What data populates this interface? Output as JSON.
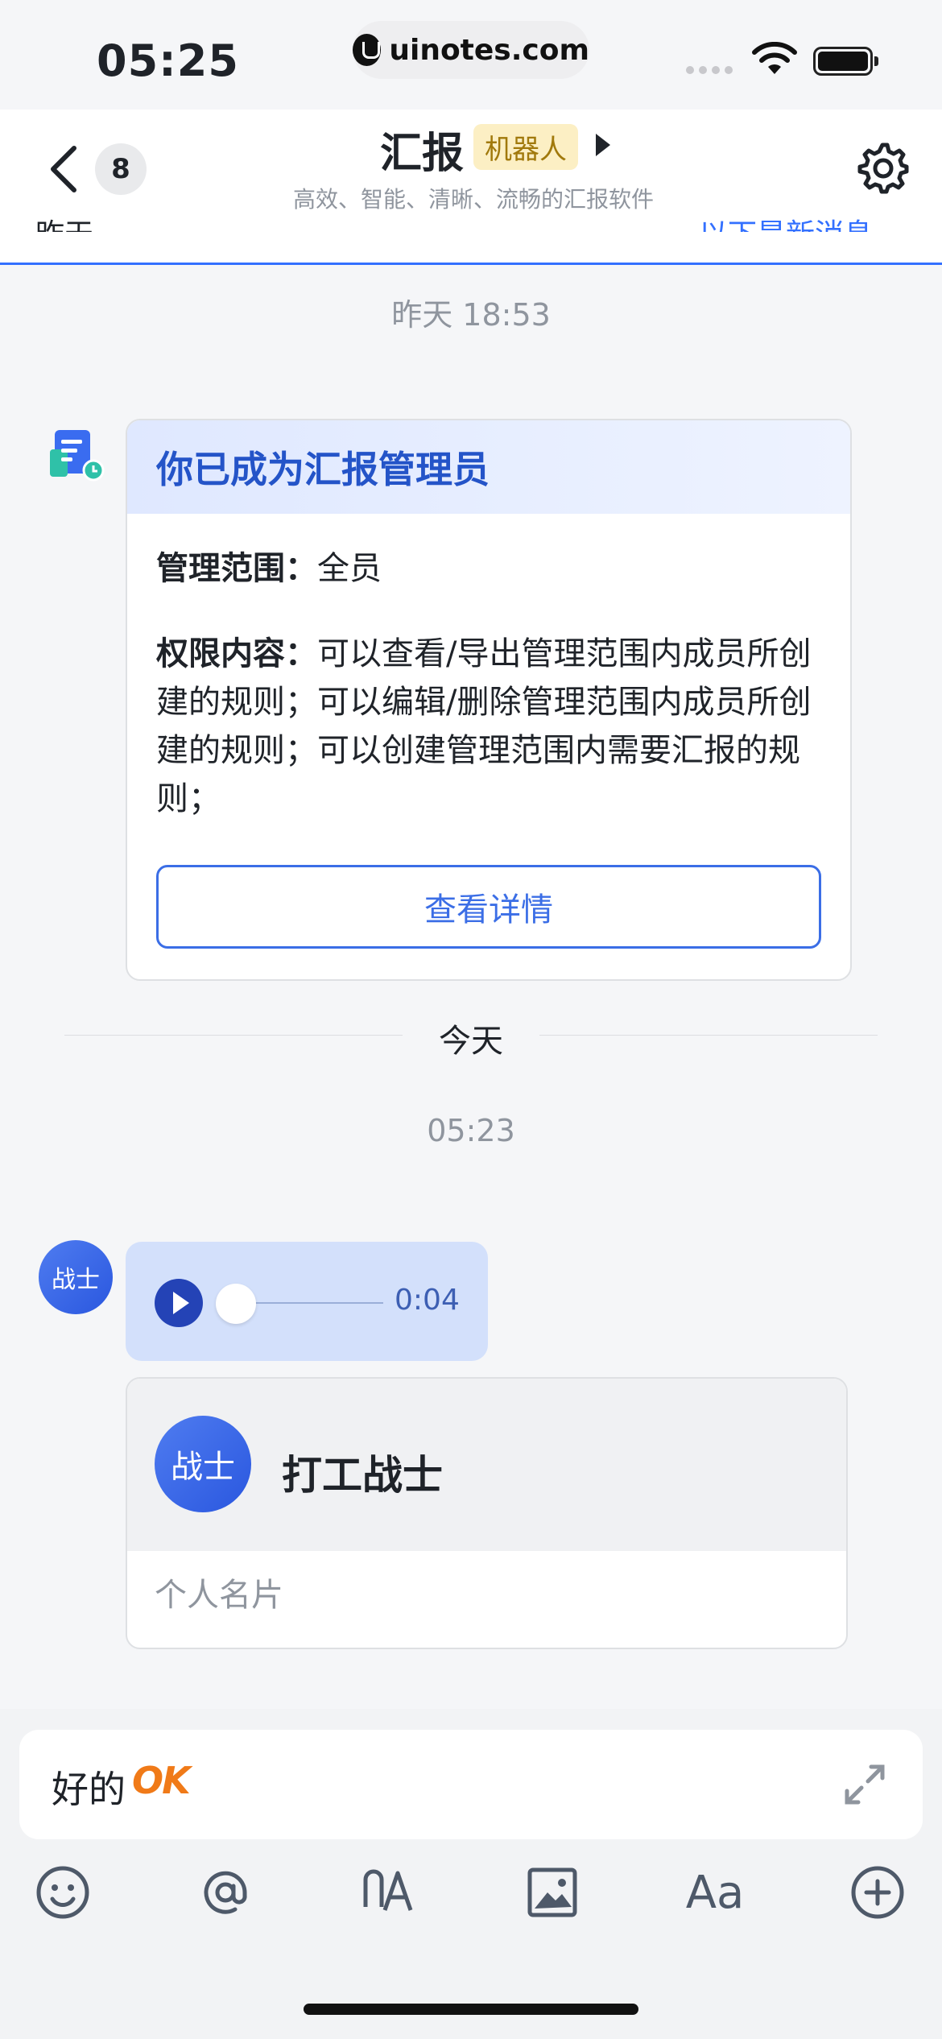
{
  "status_bar": {
    "time": "05:25",
    "url": "uinotes.com"
  },
  "header": {
    "unread_count": "8",
    "title": "汇报",
    "tag": "机器人",
    "subtitle": "高效、智能、清晰、流畅的汇报软件",
    "ghost_left": "昨天",
    "ghost_right": "以下是新消息"
  },
  "messages": {
    "time_1": "昨天 18:53",
    "admin_card": {
      "title": "你已成为汇报管理员",
      "scope_label": "管理范围：",
      "scope_value": "全员",
      "perm_label": "权限内容：",
      "perm_value": "可以查看/导出管理范围内成员所创建的规则；可以编辑/删除管理范围内成员所创建的规则；可以创建管理范围内需要汇报的规则；",
      "button": "查看详情"
    },
    "day_divider": "今天",
    "time_2": "05:23",
    "user_avatar_text": "战士",
    "voice": {
      "duration": "0:04",
      "progress": 0
    },
    "name_card": {
      "avatar_text": "战士",
      "name": "打工战士",
      "type": "个人名片"
    }
  },
  "composer": {
    "text": "好的",
    "sticker": "OK"
  },
  "toolbar": {
    "format_label": "Aa"
  },
  "colors": {
    "accent": "#3370ff",
    "card_title": "#2454c8",
    "bot_tag_bg": "#fcefc4"
  }
}
